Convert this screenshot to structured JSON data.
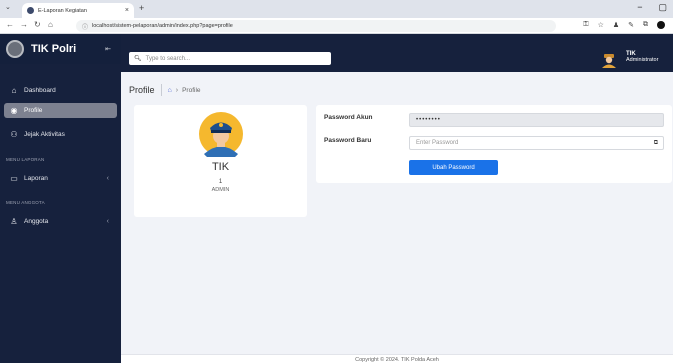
{
  "browser": {
    "tab_title": "E-Laporan Kegiatan",
    "tab_close": "×",
    "new_tab": "+",
    "url": "localhost/sistem-pelaporan/admin/index.php?page=profile"
  },
  "sidebar": {
    "brand": "TIK Polri",
    "items": [
      {
        "label": "Dashboard",
        "icon": "home-icon"
      },
      {
        "label": "Profile",
        "icon": "user-circle-icon"
      },
      {
        "label": "Jejak Aktivitas",
        "icon": "people-icon"
      },
      {
        "label": "Laporan",
        "icon": "message-icon"
      },
      {
        "label": "Anggota",
        "icon": "user-icon"
      }
    ],
    "headers": {
      "laporan": "MENU LAPORAN",
      "anggota": "MENU ANGGOTA"
    }
  },
  "topbar": {
    "search_placeholder": "Type to search...",
    "user_name": "TIK",
    "user_role": "Administrator"
  },
  "breadcrumb": {
    "title": "Profile",
    "current": "Profile"
  },
  "profile": {
    "name": "TIK",
    "id": "1",
    "role": "ADMIN"
  },
  "form": {
    "password_akun_label": "Password Akun",
    "password_akun_value": "••••••••",
    "password_baru_label": "Password Baru",
    "password_baru_placeholder": "Enter Password",
    "submit_label": "Ubah Password"
  },
  "footer": {
    "text": "Copyright © 2024. TIK Polda Aceh"
  },
  "colors": {
    "sidebar_bg": "#16213d",
    "active_item": "#7d8190",
    "primary": "#1a72e8",
    "page_bg": "#f1f3f8"
  }
}
